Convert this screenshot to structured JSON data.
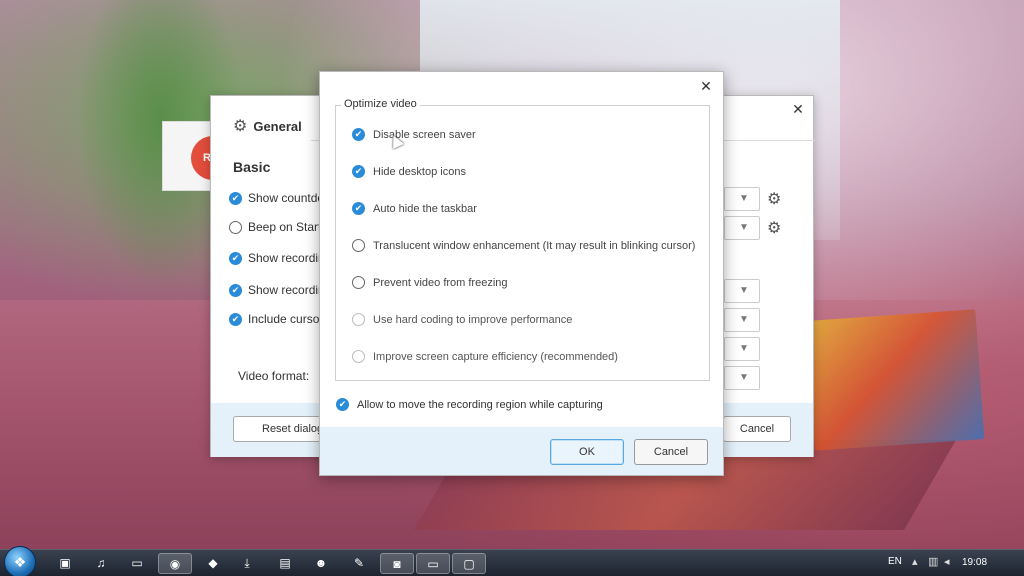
{
  "back_dialog": {
    "title": "General",
    "section": "Basic",
    "options": [
      {
        "label": "Show countdo",
        "checked": true
      },
      {
        "label": "Beep on Start",
        "checked": false
      },
      {
        "label": "Show recordin",
        "checked": true
      },
      {
        "label": "Show recordin",
        "checked": true
      },
      {
        "label": "Include cursor",
        "checked": true
      }
    ],
    "video_format_label": "Video format:",
    "reset_label": "Reset dialog",
    "cancel_label": "Cancel",
    "close_glyph": "✕"
  },
  "recorder_chip": {
    "label": "R"
  },
  "optimize_dialog": {
    "close_glyph": "✕",
    "group_title": "Optimize video",
    "options": [
      {
        "label": "Disable screen saver",
        "checked": true,
        "enabled": true
      },
      {
        "label": "Hide desktop icons",
        "checked": true,
        "enabled": true
      },
      {
        "label": "Auto hide the taskbar",
        "checked": true,
        "enabled": true
      },
      {
        "label": "Translucent window enhancement (It may result in blinking cursor)",
        "checked": false,
        "enabled": true
      },
      {
        "label": "Prevent video from freezing",
        "checked": false,
        "enabled": true
      },
      {
        "label": "Use hard coding to improve performance",
        "checked": false,
        "enabled": false
      },
      {
        "label": "Improve screen capture efficiency (recommended)",
        "checked": false,
        "enabled": false
      }
    ],
    "allow_move": {
      "label": "Allow to move the recording region while capturing",
      "checked": true
    },
    "ok_label": "OK",
    "cancel_label": "Cancel"
  },
  "taskbar": {
    "language": "EN",
    "time": "19:08"
  },
  "colors": {
    "accent": "#2a8bd8",
    "footer_bg": "#e4f1fb"
  }
}
